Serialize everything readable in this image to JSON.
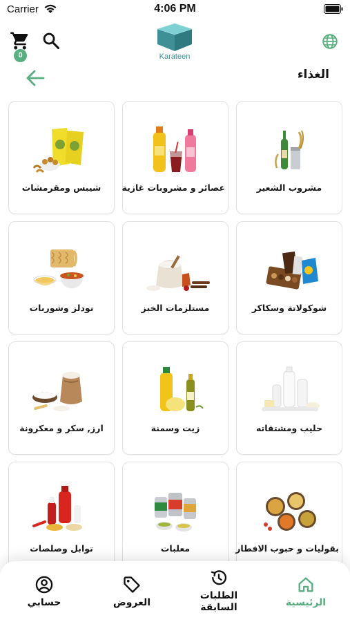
{
  "status_bar": {
    "carrier": "Carrier",
    "time": "4:06 PM"
  },
  "header": {
    "cart_count": "0",
    "logo_text": "Karateen",
    "title": "الغذاء"
  },
  "categories": [
    {
      "label": "مشروب الشعير",
      "icon": "malt-drink-image"
    },
    {
      "label": "عصائر و مشروبات غازية",
      "icon": "juice-soda-image"
    },
    {
      "label": "شيبس ومقرمشات",
      "icon": "chips-image"
    },
    {
      "label": "شوكولاتة وسكاكر",
      "icon": "chocolate-image"
    },
    {
      "label": "مستلزمات الخبز",
      "icon": "baking-image"
    },
    {
      "label": "نودلز وشوربات",
      "icon": "noodles-image"
    },
    {
      "label": "حليب ومشتقاته",
      "icon": "milk-image"
    },
    {
      "label": "زيت وسمنة",
      "icon": "oil-image"
    },
    {
      "label": "ارز, سكر و معكرونة",
      "icon": "rice-image"
    },
    {
      "label": "بقوليات و حبوب الافطار",
      "icon": "legumes-image"
    },
    {
      "label": "معلبات",
      "icon": "canned-image"
    },
    {
      "label": "توابل وصلصات",
      "icon": "spices-image"
    }
  ],
  "nav": {
    "home": "الرئيسية",
    "orders_line1": "الطلبات",
    "orders_line2": "السابقة",
    "offers": "العروض",
    "account": "حسابي"
  },
  "colors": {
    "accent": "#57ae7e",
    "logo": "#3a8f97"
  }
}
